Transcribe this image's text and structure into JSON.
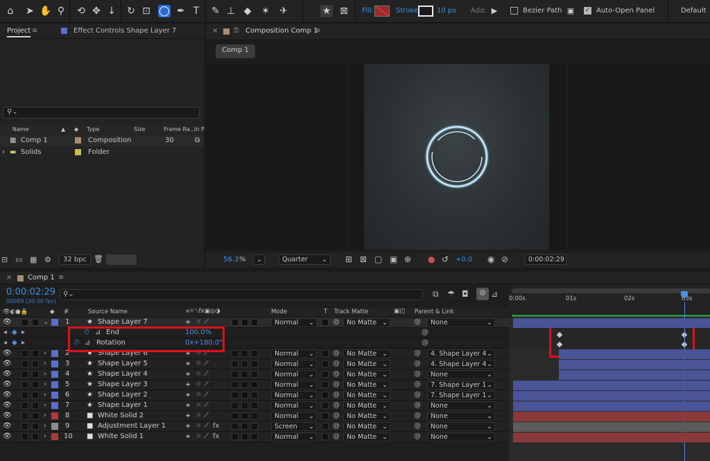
{
  "toolbar": {
    "fill_label": "Fill:",
    "stroke_label": "Stroke:",
    "stroke_width": "10 px",
    "add_label": "Add:",
    "bezier_label": "Bezier Path",
    "auto_open_label": "Auto-Open Panel",
    "workspace": "Default"
  },
  "project": {
    "tab_project": "Project",
    "tab_effect": "Effect Controls Shape Layer 7",
    "search_placeholder": "",
    "columns": {
      "name": "Name",
      "type": "Type",
      "size": "Size",
      "frame_rate": "Frame Ra...",
      "in_point": "In P"
    },
    "items": [
      {
        "name": "Comp 1",
        "type": "Composition",
        "frame_rate": "30",
        "label_color": "#a88e6c"
      },
      {
        "name": "Solids",
        "type": "Folder",
        "frame_rate": "",
        "label_color": "#c8bb4a"
      }
    ],
    "bpc": "32 bpc"
  },
  "comp": {
    "tab_title": "Composition Comp 1",
    "breadcrumb": "Comp 1",
    "zoom": "56.3",
    "zoom_unit": "%",
    "resolution": "Quarter",
    "exposure": "+0.0",
    "timecode": "0:00:02:29"
  },
  "timeline": {
    "tab_title": "Comp 1",
    "current_time": "0:00:02:29",
    "frame_info": "00089 (30.00 fps)",
    "columns": {
      "number": "#",
      "source_name": "Source Name",
      "mode": "Mode",
      "t": "T",
      "track_matte": "Track Matte",
      "parent": "Parent & Link"
    },
    "ruler": [
      "0:00s",
      "01s",
      "02s",
      "03s"
    ],
    "layers": [
      {
        "num": "1",
        "name": "Shape Layer 7",
        "mode": "Normal",
        "matte": "No Matte",
        "parent": "None",
        "color": "#5a6fd0",
        "bar": "#4a5498"
      },
      {
        "num": "2",
        "name": "Shape Layer 6",
        "mode": "Normal",
        "matte": "No Matte",
        "parent": "4. Shape Layer 4",
        "color": "#5a6fd0",
        "bar": "#4a5498"
      },
      {
        "num": "3",
        "name": "Shape Layer 5",
        "mode": "Normal",
        "matte": "No Matte",
        "parent": "4. Shape Layer 4",
        "color": "#5a6fd0",
        "bar": "#4a5498"
      },
      {
        "num": "4",
        "name": "Shape Layer 4",
        "mode": "Normal",
        "matte": "No Matte",
        "parent": "None",
        "color": "#5a6fd0",
        "bar": "#4a5498"
      },
      {
        "num": "5",
        "name": "Shape Layer 3",
        "mode": "Normal",
        "matte": "No Matte",
        "parent": "7. Shape Layer 1",
        "color": "#5a6fd0",
        "bar": "#4a5498"
      },
      {
        "num": "6",
        "name": "Shape Layer 2",
        "mode": "Normal",
        "matte": "No Matte",
        "parent": "7. Shape Layer 1",
        "color": "#5a6fd0",
        "bar": "#4a5498"
      },
      {
        "num": "7",
        "name": "Shape Layer 1",
        "mode": "Normal",
        "matte": "No Matte",
        "parent": "None",
        "color": "#5a6fd0",
        "bar": "#4a5498"
      },
      {
        "num": "8",
        "name": "White Solid 2",
        "mode": "Normal",
        "matte": "No Matte",
        "parent": "None",
        "color": "#b03a3a",
        "bar": "#8a3a3a"
      },
      {
        "num": "9",
        "name": "Adjustment Layer 1",
        "mode": "Screen",
        "matte": "No Matte",
        "parent": "None",
        "color": "#8e8e8e",
        "bar": "#5c5c5c"
      },
      {
        "num": "10",
        "name": "White Solid 1",
        "mode": "Normal",
        "matte": "No Matte",
        "parent": "None",
        "color": "#b03a3a",
        "bar": "#8a3a3a"
      }
    ],
    "properties": [
      {
        "name": "End",
        "value": "100.0%"
      },
      {
        "name": "Rotation",
        "value": "0x+180.0°"
      }
    ]
  },
  "colors": {
    "accent": "#3d8fe0",
    "highlight": "#e0101a"
  }
}
